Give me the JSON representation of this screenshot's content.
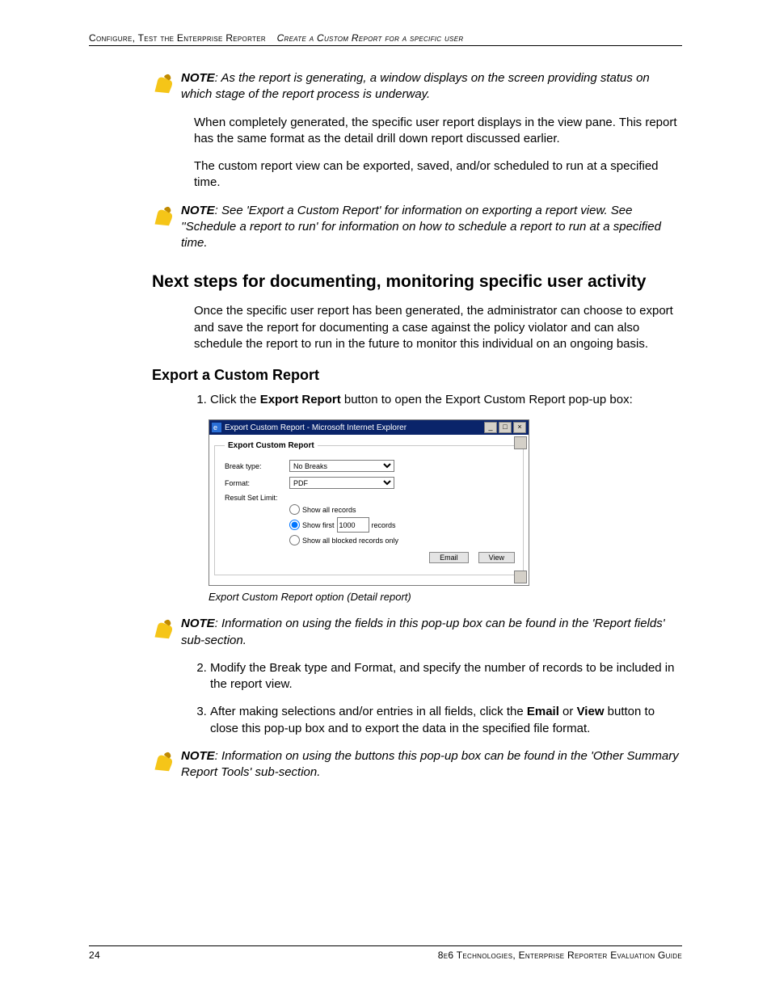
{
  "header": {
    "section1": "Configure, Test the Enterprise Reporter",
    "section2": "Create a Custom Report for a specific user"
  },
  "notes": {
    "n1": "NOTE: As the report is generating, a window displays on the screen providing status on which stage of the report process is underway.",
    "n2": "NOTE: See 'Export a Custom Report' for information on exporting a report view. See ''Schedule a report to run' for information on how to schedule a report to run at a specified time.",
    "n3": "NOTE: Information on using the fields in this pop-up box can be found in the 'Report fields' sub-section.",
    "n4": "NOTE: Information on using the buttons this pop-up box can be found in the 'Other Summary Report Tools' sub-section."
  },
  "paras": {
    "p1": "When completely generated, the specific user report displays in the view pane. This report has the same format as the detail drill down report discussed earlier.",
    "p2": "The custom report view can be exported, saved, and/or scheduled to run at a specified time.",
    "p3": "Once the specific user report has been generated, the administrator can choose to export and save the report for documenting a case against the policy violator and can also schedule the report to run in the future to monitor this individual on an ongoing basis."
  },
  "headings": {
    "h2": "Next steps for documenting, monitoring specific user activity",
    "h3": "Export a Custom Report"
  },
  "steps": {
    "s1_pre": "Click the ",
    "s1_bold": "Export Report",
    "s1_post": " button to open the Export Custom Report pop-up box:",
    "s2": "Modify the Break type and Format, and specify the number of records to be included in the report view.",
    "s3_pre": "After making selections and/or entries in all fields, click the ",
    "s3_b1": "Email",
    "s3_mid": " or ",
    "s3_b2": "View",
    "s3_post": " button to close this pop-up box and to export the data in the specified file format."
  },
  "caption": "Export Custom Report option (Detail report)",
  "popup": {
    "title": "Export Custom Report - Microsoft Internet Explorer",
    "legend": "Export Custom Report",
    "labels": {
      "break": "Break type:",
      "format": "Format:",
      "limit": "Result Set Limit:"
    },
    "values": {
      "break": "No Breaks",
      "format": "PDF",
      "show_first_n": "1000"
    },
    "radios": {
      "r1": "Show all records",
      "r2a": "Show first",
      "r2b": "records",
      "r3": "Show all blocked records only"
    },
    "buttons": {
      "email": "Email",
      "view": "View"
    }
  },
  "footer": {
    "page": "24",
    "text": "8e6 Technologies, Enterprise Reporter Evaluation Guide"
  }
}
